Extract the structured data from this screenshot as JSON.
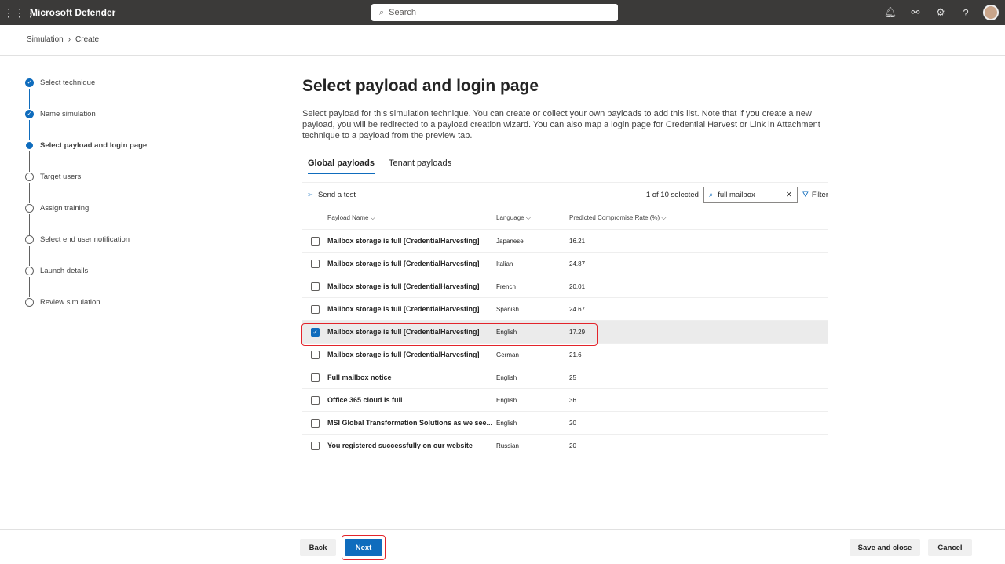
{
  "app": {
    "title": "Microsoft Defender",
    "search_placeholder": "Search"
  },
  "breadcrumb": [
    "Simulation",
    "Create"
  ],
  "steps": [
    {
      "label": "Select technique",
      "state": "done"
    },
    {
      "label": "Name simulation",
      "state": "done"
    },
    {
      "label": "Select payload and login page",
      "state": "current"
    },
    {
      "label": "Target users",
      "state": "todo"
    },
    {
      "label": "Assign training",
      "state": "todo"
    },
    {
      "label": "Select end user notification",
      "state": "todo"
    },
    {
      "label": "Launch details",
      "state": "todo"
    },
    {
      "label": "Review simulation",
      "state": "todo"
    }
  ],
  "main": {
    "title": "Select payload and login page",
    "description": "Select payload for this simulation technique. You can create or collect your own payloads to add this list. Note that if you create a new payload, you will be redirected to a payload creation wizard. You can also map a login page for Credential Harvest or Link in Attachment technique to a payload from the preview tab.",
    "tabs": [
      "Global payloads",
      "Tenant payloads"
    ],
    "send_test": "Send a test",
    "selected_count": "1 of 10 selected",
    "filter_value": "full mailbox",
    "filter_label": "Filter",
    "columns": [
      "Payload Name",
      "Language",
      "Predicted Compromise Rate (%)"
    ],
    "rows": [
      {
        "name": "Mailbox storage is full [CredentialHarvesting]",
        "lang": "Japanese",
        "rate": "16.21",
        "checked": false
      },
      {
        "name": "Mailbox storage is full [CredentialHarvesting]",
        "lang": "Italian",
        "rate": "24.87",
        "checked": false
      },
      {
        "name": "Mailbox storage is full [CredentialHarvesting]",
        "lang": "French",
        "rate": "20.01",
        "checked": false
      },
      {
        "name": "Mailbox storage is full [CredentialHarvesting]",
        "lang": "Spanish",
        "rate": "24.67",
        "checked": false
      },
      {
        "name": "Mailbox storage is full [CredentialHarvesting]",
        "lang": "English",
        "rate": "17.29",
        "checked": true
      },
      {
        "name": "Mailbox storage is full [CredentialHarvesting]",
        "lang": "German",
        "rate": "21.6",
        "checked": false
      },
      {
        "name": "Full mailbox notice",
        "lang": "English",
        "rate": "25",
        "checked": false
      },
      {
        "name": "Office 365 cloud is full",
        "lang": "English",
        "rate": "36",
        "checked": false
      },
      {
        "name": "MSI Global Transformation Solutions as we see...",
        "lang": "English",
        "rate": "20",
        "checked": false
      },
      {
        "name": "You registered successfully on our website",
        "lang": "Russian",
        "rate": "20",
        "checked": false
      }
    ]
  },
  "footer": {
    "back": "Back",
    "next": "Next",
    "save_close": "Save and close",
    "cancel": "Cancel"
  }
}
